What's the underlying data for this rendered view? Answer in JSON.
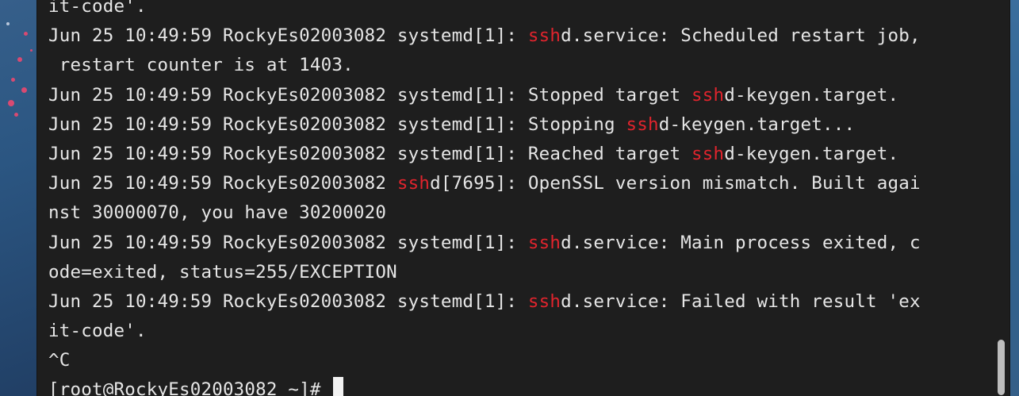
{
  "terminal": {
    "lines": [
      [
        {
          "t": "it-code'."
        }
      ],
      [
        {
          "t": "Jun 25 10:49:59 RockyEs02003082 systemd[1]: "
        },
        {
          "t": "ssh",
          "hl": true
        },
        {
          "t": "d.service: Scheduled restart job,"
        }
      ],
      [
        {
          "t": " restart counter is at 1403."
        }
      ],
      [
        {
          "t": "Jun 25 10:49:59 RockyEs02003082 systemd[1]: Stopped target "
        },
        {
          "t": "ssh",
          "hl": true
        },
        {
          "t": "d-keygen.target."
        }
      ],
      [
        {
          "t": "Jun 25 10:49:59 RockyEs02003082 systemd[1]: Stopping "
        },
        {
          "t": "ssh",
          "hl": true
        },
        {
          "t": "d-keygen.target..."
        }
      ],
      [
        {
          "t": "Jun 25 10:49:59 RockyEs02003082 systemd[1]: Reached target "
        },
        {
          "t": "ssh",
          "hl": true
        },
        {
          "t": "d-keygen.target."
        }
      ],
      [
        {
          "t": "Jun 25 10:49:59 RockyEs02003082 "
        },
        {
          "t": "ssh",
          "hl": true
        },
        {
          "t": "d[7695]: OpenSSL version mismatch. Built agai"
        }
      ],
      [
        {
          "t": "nst 30000070, you have 30200020"
        }
      ],
      [
        {
          "t": "Jun 25 10:49:59 RockyEs02003082 systemd[1]: "
        },
        {
          "t": "ssh",
          "hl": true
        },
        {
          "t": "d.service: Main process exited, c"
        }
      ],
      [
        {
          "t": "ode=exited, status=255/EXCEPTION"
        }
      ],
      [
        {
          "t": "Jun 25 10:49:59 RockyEs02003082 systemd[1]: "
        },
        {
          "t": "ssh",
          "hl": true
        },
        {
          "t": "d.service: Failed with result 'ex"
        }
      ],
      [
        {
          "t": "it-code'."
        }
      ],
      [
        {
          "t": "^C"
        }
      ]
    ],
    "prompt": "[root@RockyEs02003082 ~]# "
  },
  "colors": {
    "background": "#1e1e1e",
    "text": "#e6e6e6",
    "highlight": "#e0242d"
  }
}
